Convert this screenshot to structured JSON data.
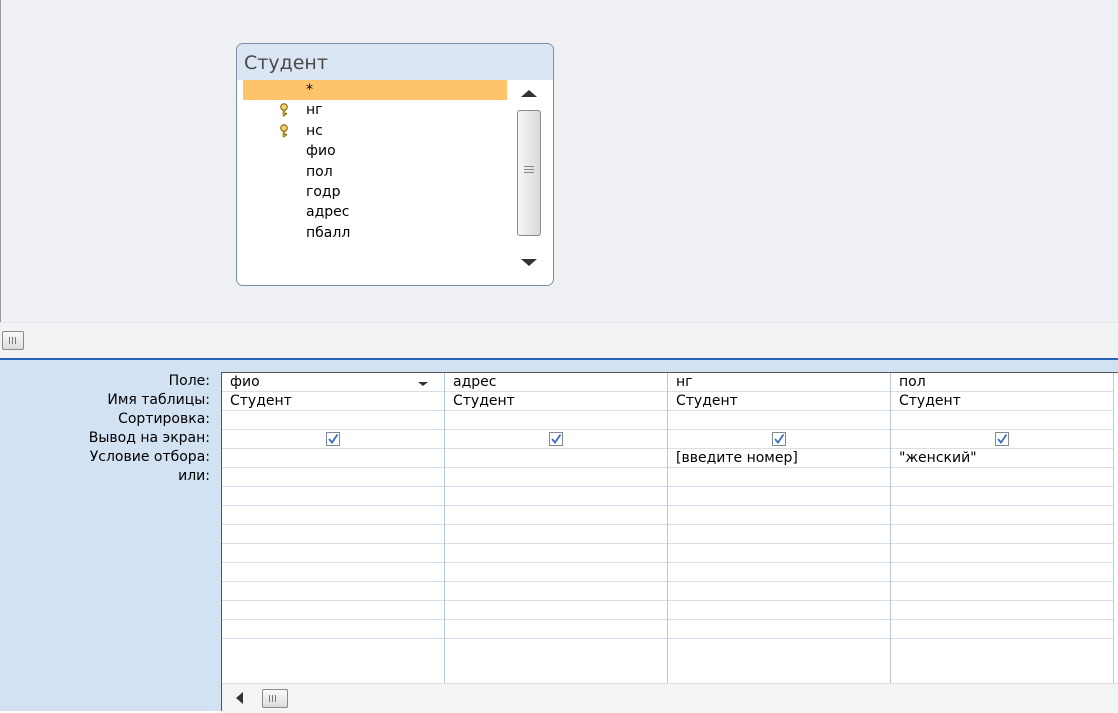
{
  "colors": {
    "pane_bg": "#eef0f3",
    "grid_bg": "#d3e2f3",
    "selected_field": "#ffc36b",
    "divider": "#2a64b8"
  },
  "field_list": {
    "title": "Студент",
    "items": [
      {
        "label": "*",
        "key": false
      },
      {
        "label": "нг",
        "key": true
      },
      {
        "label": "нс",
        "key": true
      },
      {
        "label": "фио",
        "key": false
      },
      {
        "label": "пол",
        "key": false
      },
      {
        "label": "годр",
        "key": false
      },
      {
        "label": "адрес",
        "key": false
      },
      {
        "label": "пбалл",
        "key": false
      }
    ]
  },
  "design_grid": {
    "row_labels": [
      "Поле:",
      "Имя таблицы:",
      "Сортировка:",
      "Вывод на экран:",
      "Условие отбора:",
      "или:"
    ],
    "columns": [
      {
        "field": "фио",
        "table": "Студент",
        "sort": "",
        "show": true,
        "criteria": "",
        "or": ""
      },
      {
        "field": "адрес",
        "table": "Студент",
        "sort": "",
        "show": true,
        "criteria": "",
        "or": ""
      },
      {
        "field": "нг",
        "table": "Студент",
        "sort": "",
        "show": true,
        "criteria": "[введите номер]",
        "or": ""
      },
      {
        "field": "пол",
        "table": "Студент",
        "sort": "",
        "show": true,
        "criteria": "\"женский\"",
        "or": ""
      }
    ]
  }
}
